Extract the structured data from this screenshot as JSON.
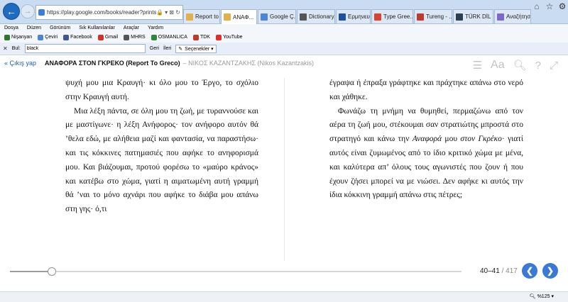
{
  "browser": {
    "address": "https://play.google.com/books/reader?printsec=fr",
    "address_tools": "🔒 ▾ ⊠ ↻",
    "tabs": [
      {
        "label": "Report to ...",
        "color": "#e3b04b",
        "active": false
      },
      {
        "label": "ΑΝΑΦ...",
        "color": "#e3b04b",
        "active": true
      },
      {
        "label": "Google Ç...",
        "color": "#4a85d9",
        "active": false
      },
      {
        "label": "Dictionary...",
        "color": "#555555",
        "active": false
      },
      {
        "label": "Ερμηνευτι...",
        "color": "#1f4fa3",
        "active": false
      },
      {
        "label": "Type Gree...",
        "color": "#d9432f",
        "active": false
      },
      {
        "label": "Tureng - ...",
        "color": "#c0392b",
        "active": false
      },
      {
        "label": "TÜRK DİL ...",
        "color": "#2c3e50",
        "active": false
      },
      {
        "label": "Αναζήτησ...",
        "color": "#7b68c9",
        "active": false
      }
    ],
    "menu": [
      "Dosya",
      "Düzen",
      "Görünüm",
      "Sık Kullanılanlar",
      "Araçlar",
      "Yardım"
    ],
    "favorites": [
      {
        "label": "Nişanyan",
        "color": "#2a7a2a"
      },
      {
        "label": "Çeviri",
        "color": "#4a85d9"
      },
      {
        "label": "Facebook",
        "color": "#3b5998"
      },
      {
        "label": "Gmail",
        "color": "#d93025"
      },
      {
        "label": "MHRS",
        "color": "#555555"
      },
      {
        "label": "OSMANLICA",
        "color": "#2a8a3a"
      },
      {
        "label": "TDK",
        "color": "#c0392b"
      },
      {
        "label": "YouTube",
        "color": "#e52d27"
      }
    ],
    "find": {
      "label": "Bul:",
      "value": "black",
      "prev": "Geri",
      "next": "İleri",
      "options": "Seçenekler ▾"
    }
  },
  "reader": {
    "back_link": "« Çıkış yap",
    "title": "ΑΝΑΦΟΡΑ ΣΤΟΝ ΓΚΡΕΚΟ (Report To Greco)",
    "author": "– ΝΙΚΟΣ ΚΑΖΑΝΤΖΑΚΗΣ (Nikos Kazantzakis)"
  },
  "left_page": {
    "p1": "ψυχή μου μια Κραυγή· κι όλο μου το Έργο, το σχόλιο στην Κραυγή αυτή.",
    "p2": "Μια λέξη πάντα, σε όλη μου τη ζωή, με τυραννούσε και με μαστίγωνε· η λέξη Ανήφορος· τον ανήφορο αυτόν θά ’θελα εδώ, με αλήθεια μαζί και φαντασία, να παραστήσω· και τις κόκκινες πατημασιές που αφήκε το ανηφορισμά μου. Και βιάζουμαι, προτού φορέσω το «μαύρο κράνος» και κατέβω στο χώμα, γιατί η αιματωμένη αυτή γραμμή θά ’ναι το μόνο αχνάρι που αφήκε το διάβα μου απάνω στη γης· ό,τι"
  },
  "right_page": {
    "p1": "έγραψα ή έπραξα γράφτηκε και πράχτηκε απάνω στο νερό και χάθηκε.",
    "p2_a": "Φωνάζω τη μνήμη να θυμηθεί, περμαζώνω από τον αέρα τη ζωή μου, στέκουμαι σαν στρατιώτης μπροστά στο στρατηγό και κάνω την ",
    "p2_i1": "Αναφορά",
    "p2_b": " μου ",
    "p2_i2": "στον Γκρέκο",
    "p2_c": "· γιατί αυτός είναι ζυμωμένος από το ίδιο κριτικό χώμα με μένα, και καλύτερα απ’ όλους τους αγωνιστές που ζουν ή που έχουν ζήσει μπορεί να με νιώσει. Δεν αφήκε κι αυτός την ίδια κόκκινη γραμμή απάνω στις πέτρες;"
  },
  "footer": {
    "page_range": "40–41",
    "page_total": "/ 417",
    "progress_fraction": 0.094
  },
  "status": {
    "zoom": "%125"
  }
}
